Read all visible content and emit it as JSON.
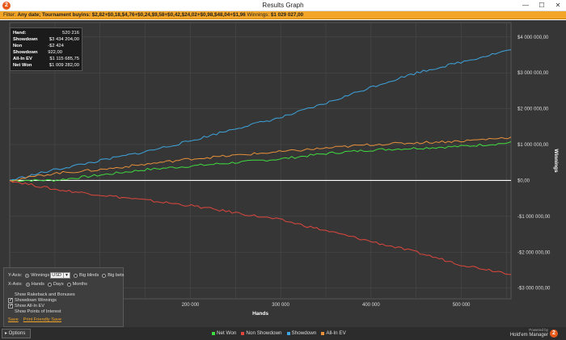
{
  "window": {
    "title": "Results Graph",
    "icon_text": "2",
    "minimize": "—",
    "maximize": "☐",
    "close": "✕"
  },
  "filter": {
    "label": "Filter:",
    "bold_text": "Any date; Tournament buyins: $2,82+$0,18,$4,76+$0,24,$9,58+$0,42,$24,02+$0,98,$48,04+$1,96",
    "winnings_label": "Winnings:",
    "winnings_value": "$1 029 027,00"
  },
  "info": [
    {
      "key": "Hand:",
      "value": "520 216"
    },
    {
      "key": "Showdown",
      "value": "$3 434 204,00"
    },
    {
      "key": "Non Showdown",
      "value": "-$2 424 922,00"
    },
    {
      "key": "All-In EV",
      "value": "$1 115 685,75"
    },
    {
      "key": "Net Won",
      "value": "$1 009 282,00"
    }
  ],
  "options": {
    "yaxis_label": "Y-Axis:",
    "y_winnings": "Winnings",
    "currency": "USD",
    "y_big_blinds": "Big blinds",
    "y_big_bets": "Big bets",
    "xaxis_label": "X-Axis:",
    "x_hands": "Hands",
    "x_days": "Days",
    "x_months": "Months",
    "show_rakeback": "Show Rakeback and Bonuses",
    "showdown_winnings": "Showdown Winnings",
    "show_allin_ev": "Show All-In EV",
    "show_poi": "Show Points of Interest",
    "save": "Save",
    "print_friendly": "Print Friendly Save"
  },
  "bottom": {
    "options_button": "▸ Options",
    "powered_by": "Powered by",
    "brand": "Hold'em Manager",
    "brand_logo": "2"
  },
  "colors": {
    "net_won": "#3fdc3f",
    "non_showdown": "#e0473c",
    "showdown": "#3da5df",
    "all_in_ev": "#e8903a",
    "accent": "#f2a526"
  },
  "chart_data": {
    "type": "line",
    "xlabel": "Hands",
    "ylabel": "Winnings",
    "xlim": [
      0,
      555000
    ],
    "ylim": [
      -3300000,
      4400000
    ],
    "x_ticks": [
      200000,
      300000,
      400000,
      500000
    ],
    "x_tick_labels": [
      "200 000",
      "300 000",
      "400 000",
      "500 000"
    ],
    "y_ticks": [
      4000000,
      3000000,
      2000000,
      1000000,
      0,
      -1000000,
      -2000000,
      -3000000
    ],
    "y_tick_labels": [
      "$4 000 000,00",
      "$3 000 000,00",
      "$2 000 000,00",
      "$1 000 000,00",
      "$0,00",
      "-$1 000 000,00",
      "-$2 000 000,00",
      "-$3 000 000,00"
    ],
    "grid": true,
    "legend_placement": "bottom",
    "x": [
      0,
      50000,
      100000,
      150000,
      200000,
      250000,
      300000,
      350000,
      400000,
      450000,
      500000,
      555000
    ],
    "series": [
      {
        "name": "Net Won",
        "color": "#3fdc3f",
        "values": [
          0,
          5000,
          150000,
          300000,
          400000,
          500000,
          600000,
          750000,
          850000,
          900000,
          950000,
          1050000
        ]
      },
      {
        "name": "Non Showdown",
        "color": "#e0473c",
        "values": [
          0,
          -250000,
          -400000,
          -550000,
          -700000,
          -900000,
          -1100000,
          -1400000,
          -1700000,
          -2000000,
          -2350000,
          -2600000
        ]
      },
      {
        "name": "Showdown",
        "color": "#3da5df",
        "values": [
          0,
          300000,
          550000,
          800000,
          1100000,
          1450000,
          1750000,
          2150000,
          2600000,
          3000000,
          3300000,
          3650000
        ]
      },
      {
        "name": "All-In EV",
        "color": "#e8903a",
        "values": [
          0,
          200000,
          300000,
          450000,
          600000,
          700000,
          800000,
          900000,
          1000000,
          1050000,
          1100000,
          1200000
        ]
      }
    ]
  }
}
